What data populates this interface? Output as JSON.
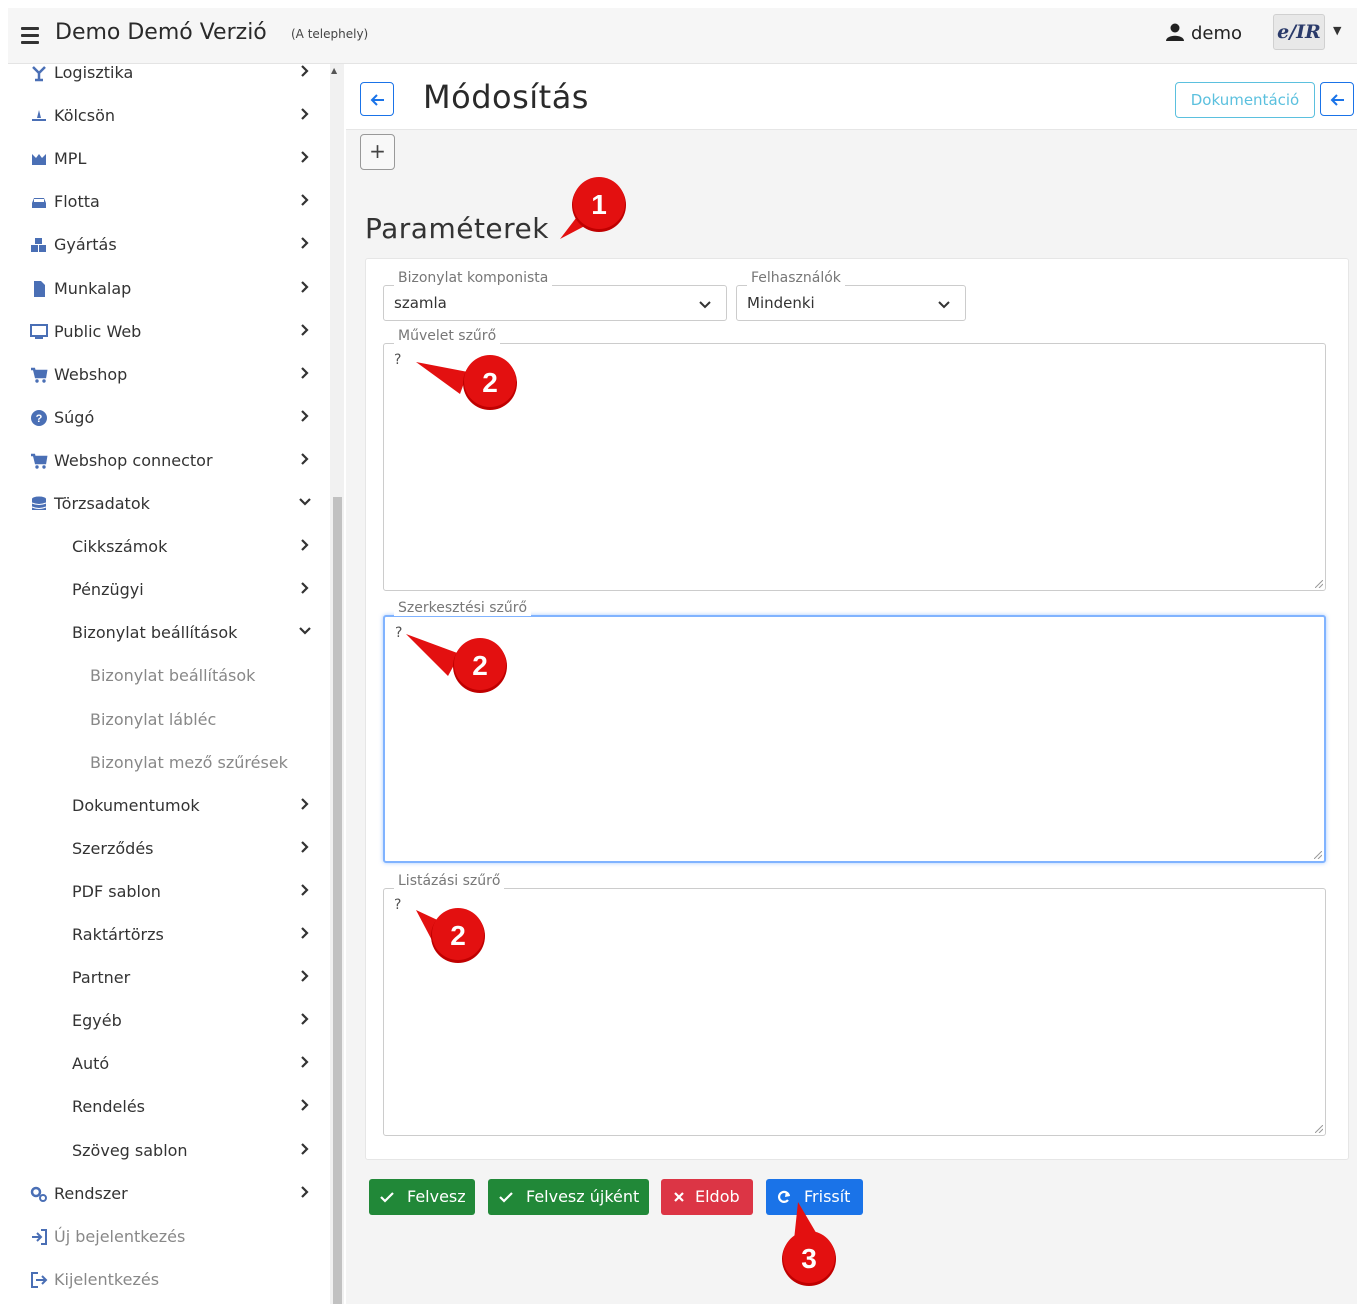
{
  "app": {
    "title": "Demo Demó Verzió",
    "subtitle": "(A telephely)",
    "user": "demo",
    "logo_text": "e/IR"
  },
  "sidebar": {
    "items": [
      {
        "label": "Logisztika",
        "icon": "logistics-icon",
        "chevron": "right",
        "dim": false
      },
      {
        "label": "Kölcsön",
        "icon": "loan-icon",
        "chevron": "right",
        "dim": false
      },
      {
        "label": "MPL",
        "icon": "mpl-icon",
        "chevron": "right",
        "dim": false
      },
      {
        "label": "Flotta",
        "icon": "car-icon",
        "chevron": "right",
        "dim": false
      },
      {
        "label": "Gyártás",
        "icon": "cubes-icon",
        "chevron": "right",
        "dim": false
      },
      {
        "label": "Munkalap",
        "icon": "file-icon",
        "chevron": "right",
        "dim": false
      },
      {
        "label": "Public Web",
        "icon": "monitor-icon",
        "chevron": "right",
        "dim": false
      },
      {
        "label": "Webshop",
        "icon": "cart-icon",
        "chevron": "right",
        "dim": false
      },
      {
        "label": "Súgó",
        "icon": "question-icon",
        "chevron": "right",
        "dim": false
      },
      {
        "label": "Webshop connector",
        "icon": "cart-icon",
        "chevron": "right",
        "dim": false
      },
      {
        "label": "Törzsadatok",
        "icon": "database-icon",
        "chevron": "down",
        "dim": false
      },
      {
        "label": "Cikkszámok",
        "icon": "",
        "chevron": "right",
        "dim": false,
        "level": 1
      },
      {
        "label": "Pénzügyi",
        "icon": "",
        "chevron": "right",
        "dim": false,
        "level": 1
      },
      {
        "label": "Bizonylat beállítások",
        "icon": "",
        "chevron": "down",
        "dim": false,
        "level": 1
      },
      {
        "label": "Bizonylat beállítások",
        "icon": "",
        "chevron": "",
        "dim": true,
        "level": 2
      },
      {
        "label": "Bizonylat lábléc",
        "icon": "",
        "chevron": "",
        "dim": true,
        "level": 2
      },
      {
        "label": "Bizonylat mező szűrések",
        "icon": "",
        "chevron": "",
        "dim": true,
        "level": 2
      },
      {
        "label": "Dokumentumok",
        "icon": "",
        "chevron": "right",
        "dim": false,
        "level": 1
      },
      {
        "label": "Szerződés",
        "icon": "",
        "chevron": "right",
        "dim": false,
        "level": 1
      },
      {
        "label": "PDF sablon",
        "icon": "",
        "chevron": "right",
        "dim": false,
        "level": 1
      },
      {
        "label": "Raktártörzs",
        "icon": "",
        "chevron": "right",
        "dim": false,
        "level": 1
      },
      {
        "label": "Partner",
        "icon": "",
        "chevron": "right",
        "dim": false,
        "level": 1
      },
      {
        "label": "Egyéb",
        "icon": "",
        "chevron": "right",
        "dim": false,
        "level": 1
      },
      {
        "label": "Autó",
        "icon": "",
        "chevron": "right",
        "dim": false,
        "level": 1
      },
      {
        "label": "Rendelés",
        "icon": "",
        "chevron": "right",
        "dim": false,
        "level": 1
      },
      {
        "label": "Szöveg sablon",
        "icon": "",
        "chevron": "right",
        "dim": false,
        "level": 1
      },
      {
        "label": "Rendszer",
        "icon": "cogs-icon",
        "chevron": "right",
        "dim": false
      },
      {
        "label": "Új bejelentkezés",
        "icon": "sign-in-icon",
        "chevron": "",
        "dim": true
      },
      {
        "label": "Kijelentkezés",
        "icon": "sign-out-icon",
        "chevron": "",
        "dim": true
      }
    ]
  },
  "page": {
    "title": "Módosítás",
    "doc_button": "Dokumentáció",
    "section_title": "Paraméterek"
  },
  "form": {
    "komponista": {
      "legend": "Bizonylat komponista",
      "value": "szamla"
    },
    "felhasznalok": {
      "legend": "Felhasználók",
      "value": "Mindenki"
    },
    "muvelet": {
      "legend": "Művelet szűrő",
      "value": "?"
    },
    "szerkesztesi": {
      "legend": "Szerkesztési szűrő",
      "value": "?"
    },
    "listazasi": {
      "legend": "Listázási szűrő",
      "value": "?"
    }
  },
  "actions": {
    "felvesz": "Felvesz",
    "felvesz_ujkent": "Felvesz újként",
    "eldob": "Eldob",
    "frissit": "Frissít"
  },
  "callouts": {
    "one": "1",
    "two_a": "2",
    "two_b": "2",
    "two_c": "2",
    "three": "3"
  },
  "colors": {
    "success": "#218838",
    "danger": "#dc3545",
    "primary": "#1a73e8",
    "info": "#5bc0de",
    "callout": "#e31010"
  }
}
